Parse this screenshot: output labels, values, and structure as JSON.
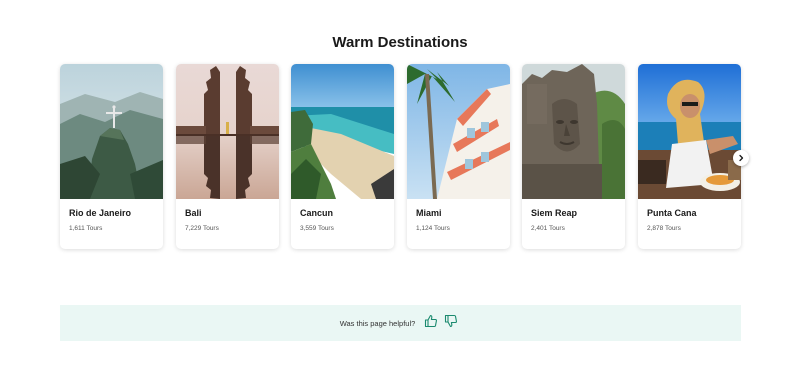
{
  "section": {
    "title": "Warm Destinations"
  },
  "destinations": [
    {
      "name": "Rio de Janeiro",
      "tours": "1,611 Tours"
    },
    {
      "name": "Bali",
      "tours": "7,229 Tours"
    },
    {
      "name": "Cancun",
      "tours": "3,559 Tours"
    },
    {
      "name": "Miami",
      "tours": "1,124 Tours"
    },
    {
      "name": "Siem Reap",
      "tours": "2,401 Tours"
    },
    {
      "name": "Punta Cana",
      "tours": "2,878 Tours"
    }
  ],
  "carousel": {
    "next_icon": "chevron-right-icon"
  },
  "feedback": {
    "question": "Was this page helpful?",
    "up_icon": "thumbs-up-icon",
    "down_icon": "thumbs-down-icon",
    "accent": "#1a8a6e",
    "background": "#eaf7f4"
  }
}
